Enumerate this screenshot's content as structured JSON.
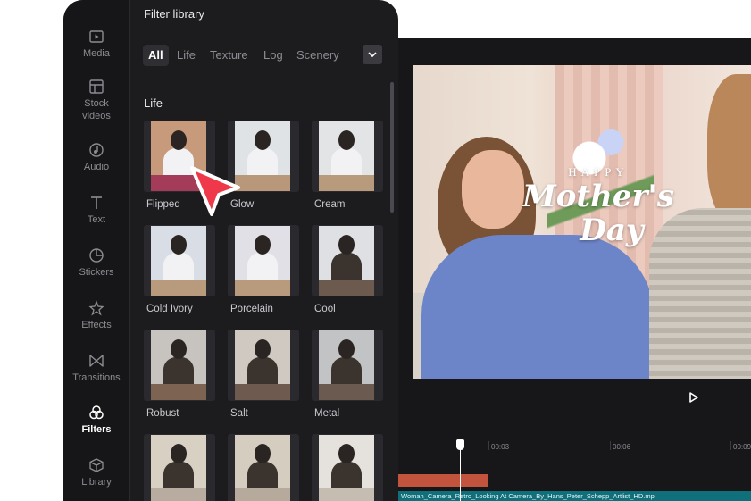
{
  "panel": {
    "title": "Filter library",
    "section_title": "Life"
  },
  "sidebar": {
    "items": [
      {
        "label": "Media",
        "icon": "media-icon",
        "active": false
      },
      {
        "label": "Stock\nvideos",
        "icon": "stock-videos-icon",
        "active": false
      },
      {
        "label": "Audio",
        "icon": "audio-icon",
        "active": false
      },
      {
        "label": "Text",
        "icon": "text-icon",
        "active": false
      },
      {
        "label": "Stickers",
        "icon": "stickers-icon",
        "active": false
      },
      {
        "label": "Effects",
        "icon": "effects-icon",
        "active": false
      },
      {
        "label": "Transitions",
        "icon": "transitions-icon",
        "active": false
      },
      {
        "label": "Filters",
        "icon": "filters-icon",
        "active": true
      },
      {
        "label": "Library",
        "icon": "library-icon",
        "active": false
      }
    ]
  },
  "tabs": {
    "items": [
      "All",
      "Life",
      "Texture",
      "Log",
      "Scenery"
    ],
    "active": "All",
    "dropdown_icon": "chevron-down-icon"
  },
  "filters": [
    {
      "label": "Flipped",
      "bg": "#c69a7a",
      "band": "#a43b58"
    },
    {
      "label": "Glow",
      "bg": "#dfe3e6",
      "band": "#b8977a"
    },
    {
      "label": "Cream",
      "bg": "#e3e4e6",
      "band": "#b89a7c"
    },
    {
      "label": "Cold Ivory",
      "bg": "#d8dde6",
      "band": "#b89a7c"
    },
    {
      "label": "Porcelain",
      "bg": "#e0e0e6",
      "band": "#b89a7c"
    },
    {
      "label": "Cool",
      "bg": "#dfe0e4",
      "band": "#6c5a4e"
    },
    {
      "label": "Robust",
      "bg": "#c7c3be",
      "band": "#7d6452"
    },
    {
      "label": "Salt",
      "bg": "#cfc9c2",
      "band": "#6e5a4e"
    },
    {
      "label": "Metal",
      "bg": "#c2c3c4",
      "band": "#6a5a50"
    },
    {
      "label": "",
      "bg": "#d9d0c4",
      "band": "#b7ac9f"
    },
    {
      "label": "",
      "bg": "#d6cdc1",
      "band": "#b5aa9c"
    },
    {
      "label": "",
      "bg": "#e5e1dc",
      "band": "#c6bdb2"
    }
  ],
  "preview": {
    "caption_small": "HAPPY",
    "caption_line1": "Mother's",
    "caption_line2": "Day",
    "play_icon": "play-icon"
  },
  "timeline": {
    "ticks": [
      "00:03",
      "00:06",
      "00:09"
    ],
    "clip_name": "Woman_Camera_Retro_Looking At Camera_By_Hans_Peter_Schepp_Artlist_HD.mp"
  },
  "colors": {
    "panel_bg": "#1c1c1f",
    "accent_pointer": "#f0384b"
  }
}
